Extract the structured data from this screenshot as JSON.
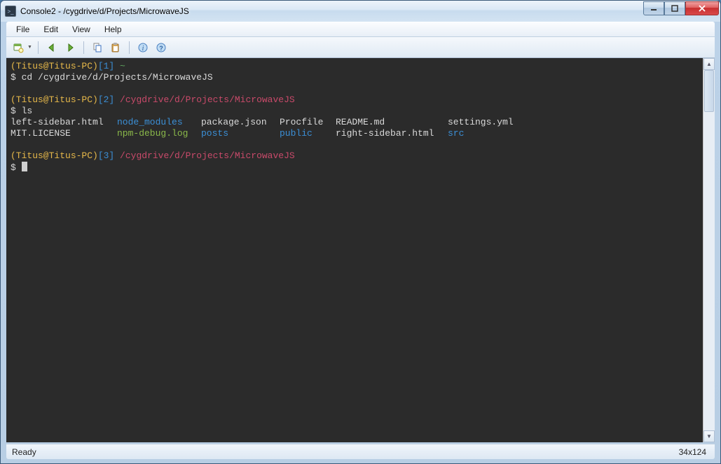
{
  "window": {
    "title": "Console2 - /cygdrive/d/Projects/MicrowaveJS"
  },
  "menu": {
    "file": "File",
    "edit": "Edit",
    "view": "View",
    "help": "Help"
  },
  "prompts": {
    "p1_user": "(Titus@Titus-PC)",
    "p1_idx": "[1]",
    "p1_path": "~",
    "p1_cmd": "cd /cygdrive/d/Projects/MicrowaveJS",
    "p2_user": "(Titus@Titus-PC)",
    "p2_idx": "[2]",
    "p2_path": "/cygdrive/d/Projects/MicrowaveJS",
    "p2_cmd": "ls",
    "p3_user": "(Titus@Titus-PC)",
    "p3_idx": "[3]",
    "p3_path": "/cygdrive/d/Projects/MicrowaveJS",
    "dollar": "$"
  },
  "ls": {
    "r1c1": "left-sidebar.html",
    "r1c2": "node_modules",
    "r1c3": "package.json",
    "r1c4": "Procfile",
    "r1c5": "README.md",
    "r1c6": "settings.yml",
    "r2c1": "MIT.LICENSE",
    "r2c2": "npm-debug.log",
    "r2c3": "posts",
    "r2c4": "public",
    "r2c5": "right-sidebar.html",
    "r2c6": "src"
  },
  "status": {
    "left": "Ready",
    "right": "34x124"
  },
  "colors": {
    "term_bg": "#2b2b2b",
    "term_fg": "#d9d9d9",
    "prompt_user": "#e6b84a",
    "prompt_path": "#c94a6a",
    "dir_color": "#3b8fd6",
    "exec_color": "#8ab84a",
    "home_green": "#60a860"
  }
}
